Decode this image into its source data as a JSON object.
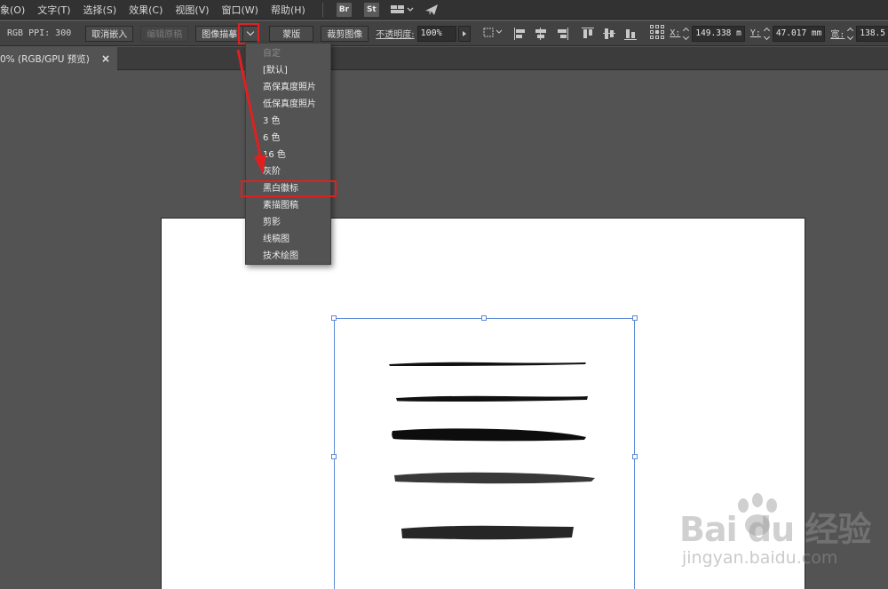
{
  "menubar": {
    "items": [
      "象(O)",
      "文字(T)",
      "选择(S)",
      "效果(C)",
      "视图(V)",
      "窗口(W)",
      "帮助(H)"
    ],
    "bridge_badge": "Br",
    "stock_badge": "St"
  },
  "controlbar": {
    "info": "RGB  PPI: 300",
    "unembed_label": "取消嵌入",
    "edit_original_label": "编辑原稿",
    "image_trace_label": "图像描摹",
    "mask_label": "蒙版",
    "crop_label": "裁剪图像",
    "opacity_label": "不透明度:",
    "opacity_value": "100%",
    "x_label": "X:",
    "x_value": "149.338 m",
    "y_label": "Y:",
    "y_value": "47.017 mm",
    "w_label": "宽:",
    "w_value": "138.5"
  },
  "tab": {
    "label": "0% (RGB/GPU 预览)",
    "close": "×"
  },
  "dropdown": {
    "items": [
      {
        "label": "自定",
        "disabled": true
      },
      {
        "label": "[默认]",
        "disabled": false
      },
      {
        "label": "高保真度照片",
        "disabled": false
      },
      {
        "label": "低保真度照片",
        "disabled": false
      },
      {
        "label": "3 色",
        "disabled": false
      },
      {
        "label": "6 色",
        "disabled": false
      },
      {
        "label": "16 色",
        "disabled": false
      },
      {
        "label": "灰阶",
        "disabled": false
      },
      {
        "label": "黑白徽标",
        "disabled": false,
        "highlighted": true
      },
      {
        "label": "素描图稿",
        "disabled": false
      },
      {
        "label": "剪影",
        "disabled": false
      },
      {
        "label": "线稿图",
        "disabled": false
      },
      {
        "label": "技术绘图",
        "disabled": false
      }
    ]
  },
  "watermark": {
    "logo": "Bai du 经验",
    "url": "jingyan.baidu.com"
  },
  "colors": {
    "annotation_red": "#e02020",
    "selection_blue": "#5b8ad6",
    "workspace_bg": "#535353"
  }
}
